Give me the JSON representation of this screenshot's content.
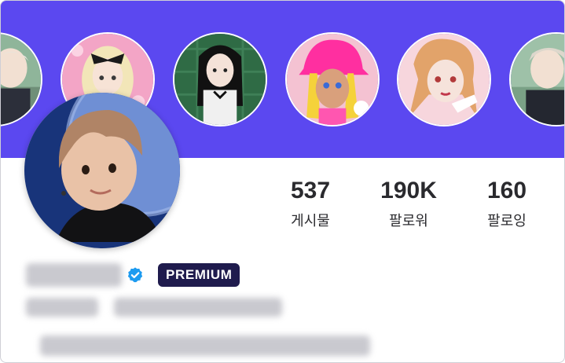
{
  "theme": {
    "banner_color": "#5b48f0",
    "verified_color": "#1d9bf0",
    "premium_bg": "#1f1b4d"
  },
  "stories": [
    {
      "name": "story-avatar-1"
    },
    {
      "name": "story-avatar-2"
    },
    {
      "name": "story-avatar-3"
    },
    {
      "name": "story-avatar-4"
    },
    {
      "name": "story-avatar-5"
    },
    {
      "name": "story-avatar-6"
    }
  ],
  "profile": {
    "badge": "PREMIUM",
    "verified_icon": "verified-check-icon"
  },
  "stats": [
    {
      "value": "537",
      "label": "게시물"
    },
    {
      "value": "190K",
      "label": "팔로워"
    },
    {
      "value": "160",
      "label": "팔로잉"
    }
  ]
}
